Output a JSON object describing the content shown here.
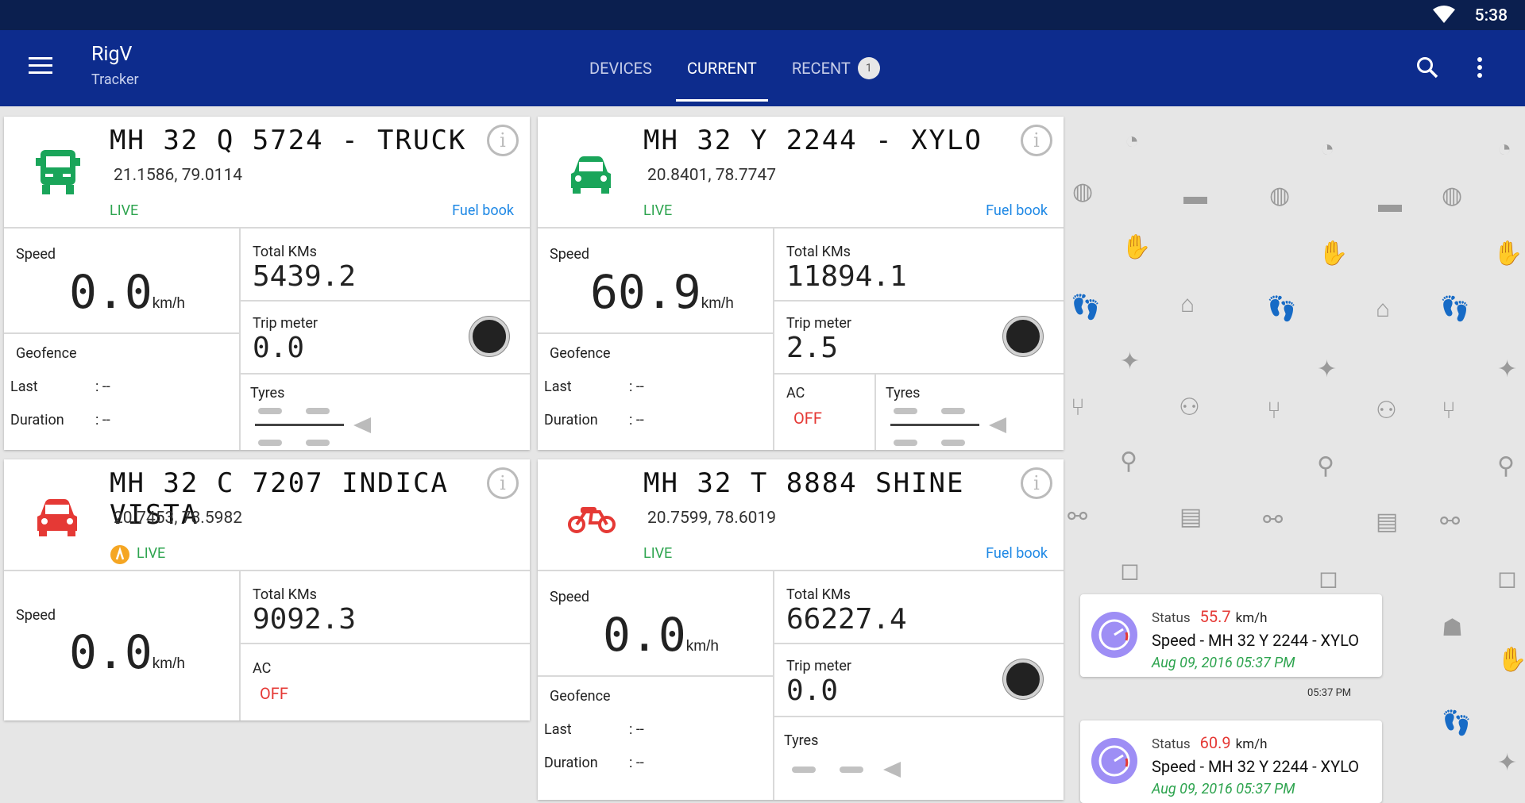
{
  "status_bar": {
    "time": "5:38"
  },
  "app": {
    "title": "RigV",
    "subtitle": "Tracker"
  },
  "tabs": [
    {
      "label": "DEVICES"
    },
    {
      "label": "CURRENT",
      "active": true
    },
    {
      "label": "RECENT",
      "badge": "1"
    }
  ],
  "labels": {
    "speed": "Speed",
    "total_kms": "Total KMs",
    "trip_meter": "Trip meter",
    "geofence": "Geofence",
    "last": "Last",
    "duration": "Duration",
    "tyres": "Tyres",
    "ac": "AC",
    "kmh": "km/h",
    "fuel_book": "Fuel book",
    "live": "LIVE",
    "colon_dash": ": --"
  },
  "cards": [
    {
      "name": "MH 32 Q 5724 - TRUCK",
      "coords": "21.1586, 79.0114",
      "speed": "0.0",
      "total_kms": "5439.2",
      "trip": "0.0",
      "icon": "truck-icon",
      "color": "#1aa55a"
    },
    {
      "name": "MH 32 Y 2244 - XYLO",
      "coords": "20.8401, 78.7747",
      "speed": "60.9",
      "total_kms": "11894.1",
      "trip": "2.5",
      "ac": "OFF",
      "icon": "car-icon",
      "color": "#1aa55a"
    },
    {
      "name": "MH 32 C 7207  INDICA VISTA",
      "coords": "20.7453, 78.5982",
      "speed": "0.0",
      "total_kms": "9092.3",
      "ac": "OFF",
      "icon": "car-icon",
      "color": "#e53935"
    },
    {
      "name": "MH 32 T 8884 SHINE",
      "coords": "20.7599, 78.6019",
      "speed": "0.0",
      "total_kms": "66227.4",
      "trip": "0.0",
      "icon": "motorbike-icon",
      "color": "#e53935"
    }
  ],
  "notifications": [
    {
      "status_label": "Status",
      "speed": "55.7",
      "unit": "km/h",
      "message": "Speed - MH 32 Y 2244 - XYLO",
      "date": "Aug 09, 2016  05:37 PM",
      "time": "05:37 PM"
    },
    {
      "status_label": "Status",
      "speed": "60.9",
      "unit": "km/h",
      "message": "Speed - MH 32 Y 2244 - XYLO",
      "date": "Aug 09, 2016  05:37 PM"
    }
  ]
}
